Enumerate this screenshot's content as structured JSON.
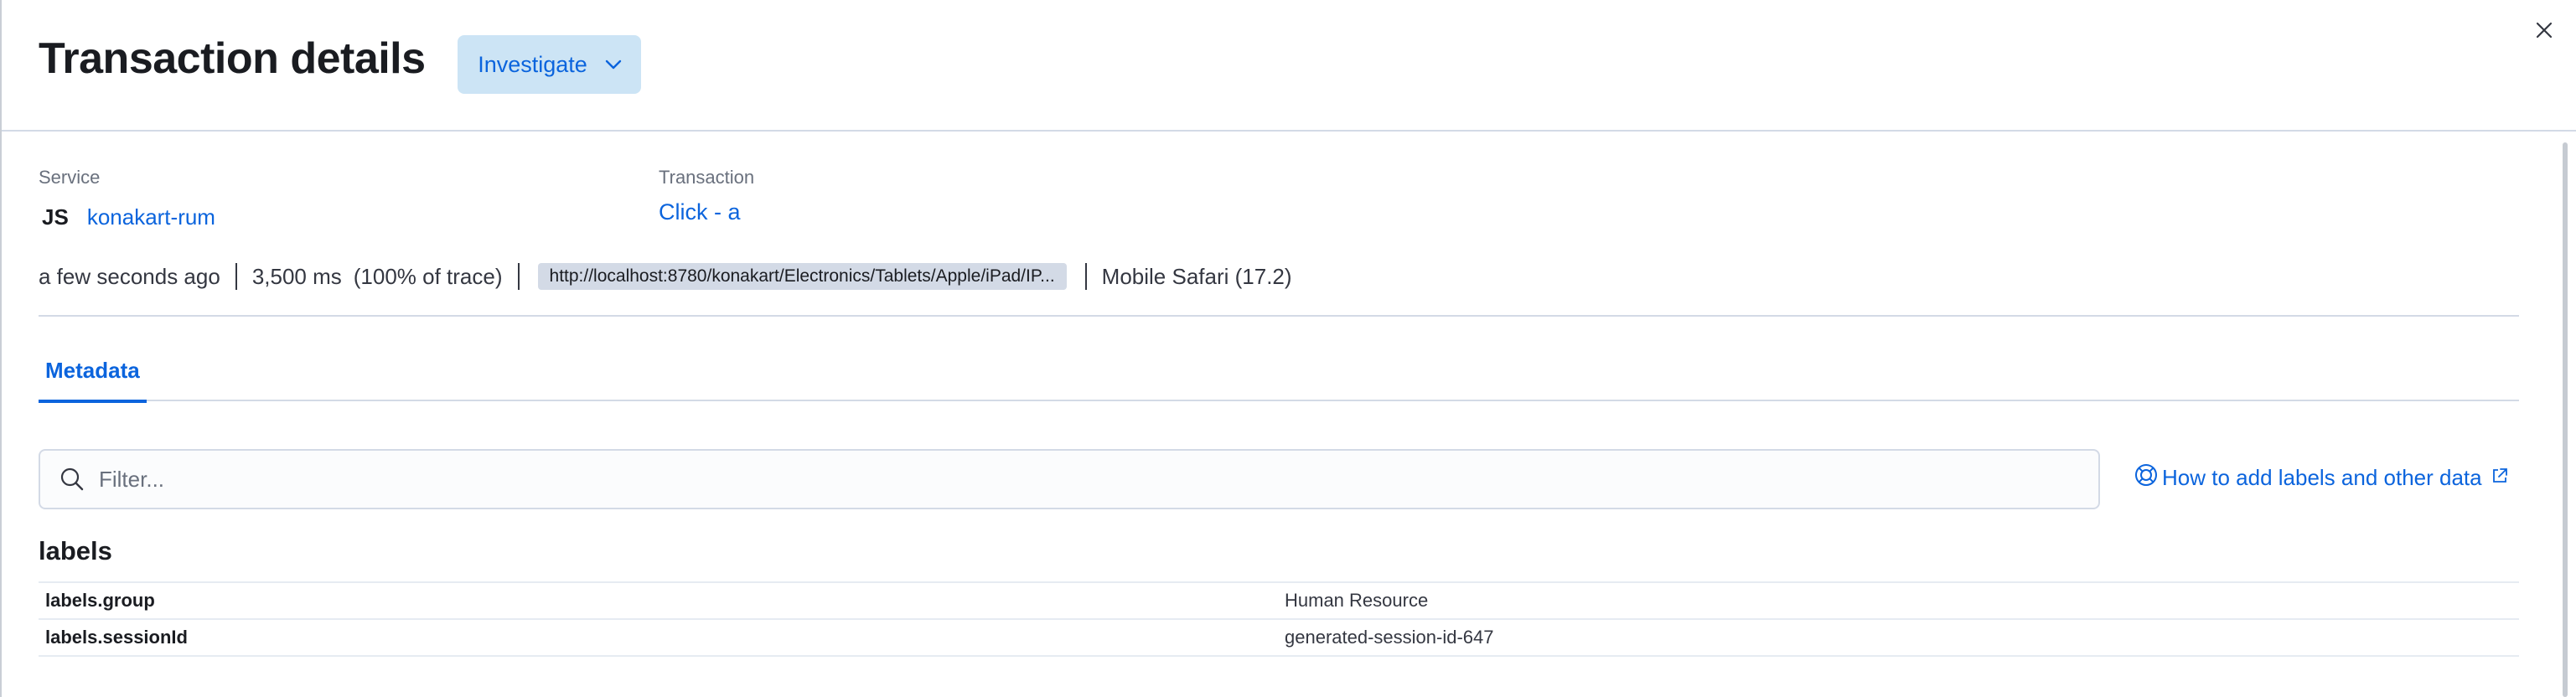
{
  "header": {
    "title": "Transaction details",
    "investigate_label": "Investigate"
  },
  "summary": {
    "service_label": "Service",
    "service_agent": "JS",
    "service_name": "konakart-rum",
    "transaction_label": "Transaction",
    "transaction_name": "Click - a",
    "timestamp": "a few seconds ago",
    "duration": "3,500 ms",
    "trace_pct": "(100% of trace)",
    "url": "http://localhost:8780/konakart/Electronics/Tablets/Apple/iPad/IP...",
    "user_agent": "Mobile Safari (17.2)"
  },
  "tabs": [
    {
      "label": "Metadata",
      "active": true
    }
  ],
  "filter": {
    "placeholder": "Filter...",
    "value": ""
  },
  "help_link": {
    "label": "How to add labels and other data"
  },
  "section": {
    "title": "labels",
    "rows": [
      {
        "key": "labels.group",
        "value": "Human Resource"
      },
      {
        "key": "labels.sessionId",
        "value": "generated-session-id-647"
      }
    ]
  },
  "colors": {
    "accent": "#0b64dd",
    "button_bg": "#cce4f5",
    "badge_bg": "#d3dae6",
    "border": "#d3dae6"
  },
  "icons": [
    "chevron-down-icon",
    "close-icon",
    "search-icon",
    "help-lifebuoy-icon",
    "external-link-icon"
  ]
}
